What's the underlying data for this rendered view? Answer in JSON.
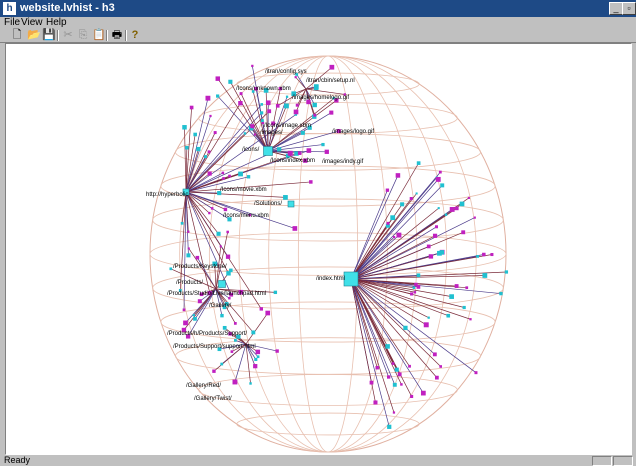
{
  "window": {
    "title": "website.lvhist - h3"
  },
  "menu": [
    "File",
    "View",
    "Help"
  ],
  "toolbar": [
    "new-file",
    "open-folder",
    "save",
    "cut",
    "copy",
    "paste",
    "print",
    "help"
  ],
  "status": "Ready",
  "graph": {
    "labels": [
      "/itran/config.sys",
      "/itran/cbin/setup.nl",
      "/Icons/unknown.xbm",
      "/images/homelogo.gif",
      "/Icons/image.xbm",
      "/images/",
      "/images/logo.gif",
      "/icons/",
      "/Icons/index.xbm",
      "/images/indy.gif",
      "/Icons/movie.xbm",
      "http://hyperbolic",
      "/Solutions/",
      "/Icons/menu.xbm",
      "/index.html",
      "/Products/Keystone/",
      "/Products/",
      "/Products/Studio/Live/launchpad.html",
      "/Gallery/",
      "/Products/h/Products/Support/",
      "/Products/Support/support.html",
      "/Gallery/Red/",
      "/Gallery/Twist/"
    ]
  }
}
